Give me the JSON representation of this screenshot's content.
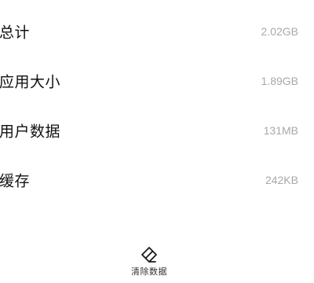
{
  "storage": {
    "items": [
      {
        "label": "总计",
        "value": "2.02GB"
      },
      {
        "label": "应用大小",
        "value": "1.89GB"
      },
      {
        "label": "用户数据",
        "value": "131MB"
      },
      {
        "label": "缓存",
        "value": "242KB"
      }
    ]
  },
  "actions": {
    "clear_data_label": "清除数据",
    "clear_data_icon": "eraser-icon"
  },
  "colors": {
    "label_text": "#111111",
    "value_text": "#a8a8a8",
    "background": "#ffffff"
  }
}
